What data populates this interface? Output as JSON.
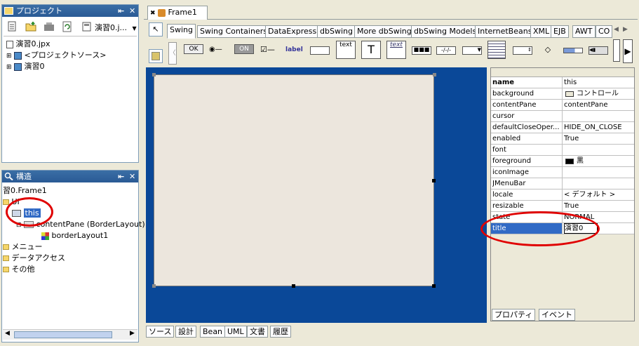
{
  "project_panel": {
    "title": "プロジェクト",
    "toolbar_file": "演習0.j...",
    "tree": [
      {
        "label": "演習0.jpx"
      },
      {
        "label": "<プロジェクトソース>"
      },
      {
        "label": "演習0"
      }
    ]
  },
  "structure_panel": {
    "title": "構造",
    "tree": [
      {
        "label": "習0.Frame1"
      },
      {
        "label": "UI"
      },
      {
        "label": "this"
      },
      {
        "label": "contentPane (BorderLayout)"
      },
      {
        "label": "borderLayout1"
      },
      {
        "label": "メニュー"
      },
      {
        "label": "データアクセス"
      },
      {
        "label": "その他"
      }
    ]
  },
  "editor_tab": {
    "label": "Frame1"
  },
  "palette": {
    "tabs": [
      "Swing",
      "Swing Containers",
      "DataExpress",
      "dbSwing",
      "More dbSwing",
      "dbSwing Models",
      "InternetBeans",
      "XML",
      "EJB",
      "AWT",
      "CO"
    ],
    "items": {
      "ok": "OK",
      "on": "ON",
      "label": "label",
      "text1": "text",
      "T": "T",
      "text2": "text"
    }
  },
  "inspector": {
    "rows": [
      {
        "name": "name",
        "value": "this"
      },
      {
        "name": "background",
        "value": "コントロール"
      },
      {
        "name": "contentPane",
        "value": "contentPane"
      },
      {
        "name": "cursor",
        "value": ""
      },
      {
        "name": "defaultCloseOper...",
        "value": "HIDE_ON_CLOSE"
      },
      {
        "name": "enabled",
        "value": "True"
      },
      {
        "name": "font",
        "value": ""
      },
      {
        "name": "foreground",
        "value": "黒"
      },
      {
        "name": "iconImage",
        "value": ""
      },
      {
        "name": "JMenuBar",
        "value": ""
      },
      {
        "name": "locale",
        "value": "< デフォルト >"
      },
      {
        "name": "resizable",
        "value": "True"
      },
      {
        "name": "state",
        "value": "NORMAL"
      },
      {
        "name": "title",
        "value": "演習0"
      }
    ],
    "tabs": [
      "プロパティ",
      "イベント"
    ]
  },
  "bottom_tabs": [
    "ソース",
    "設計",
    "Bean",
    "UML",
    "文書",
    "履歴"
  ],
  "colors": {
    "canvas": "#0a4898",
    "selection": "#316ac5",
    "highlight_ellipse": "#e00000"
  }
}
